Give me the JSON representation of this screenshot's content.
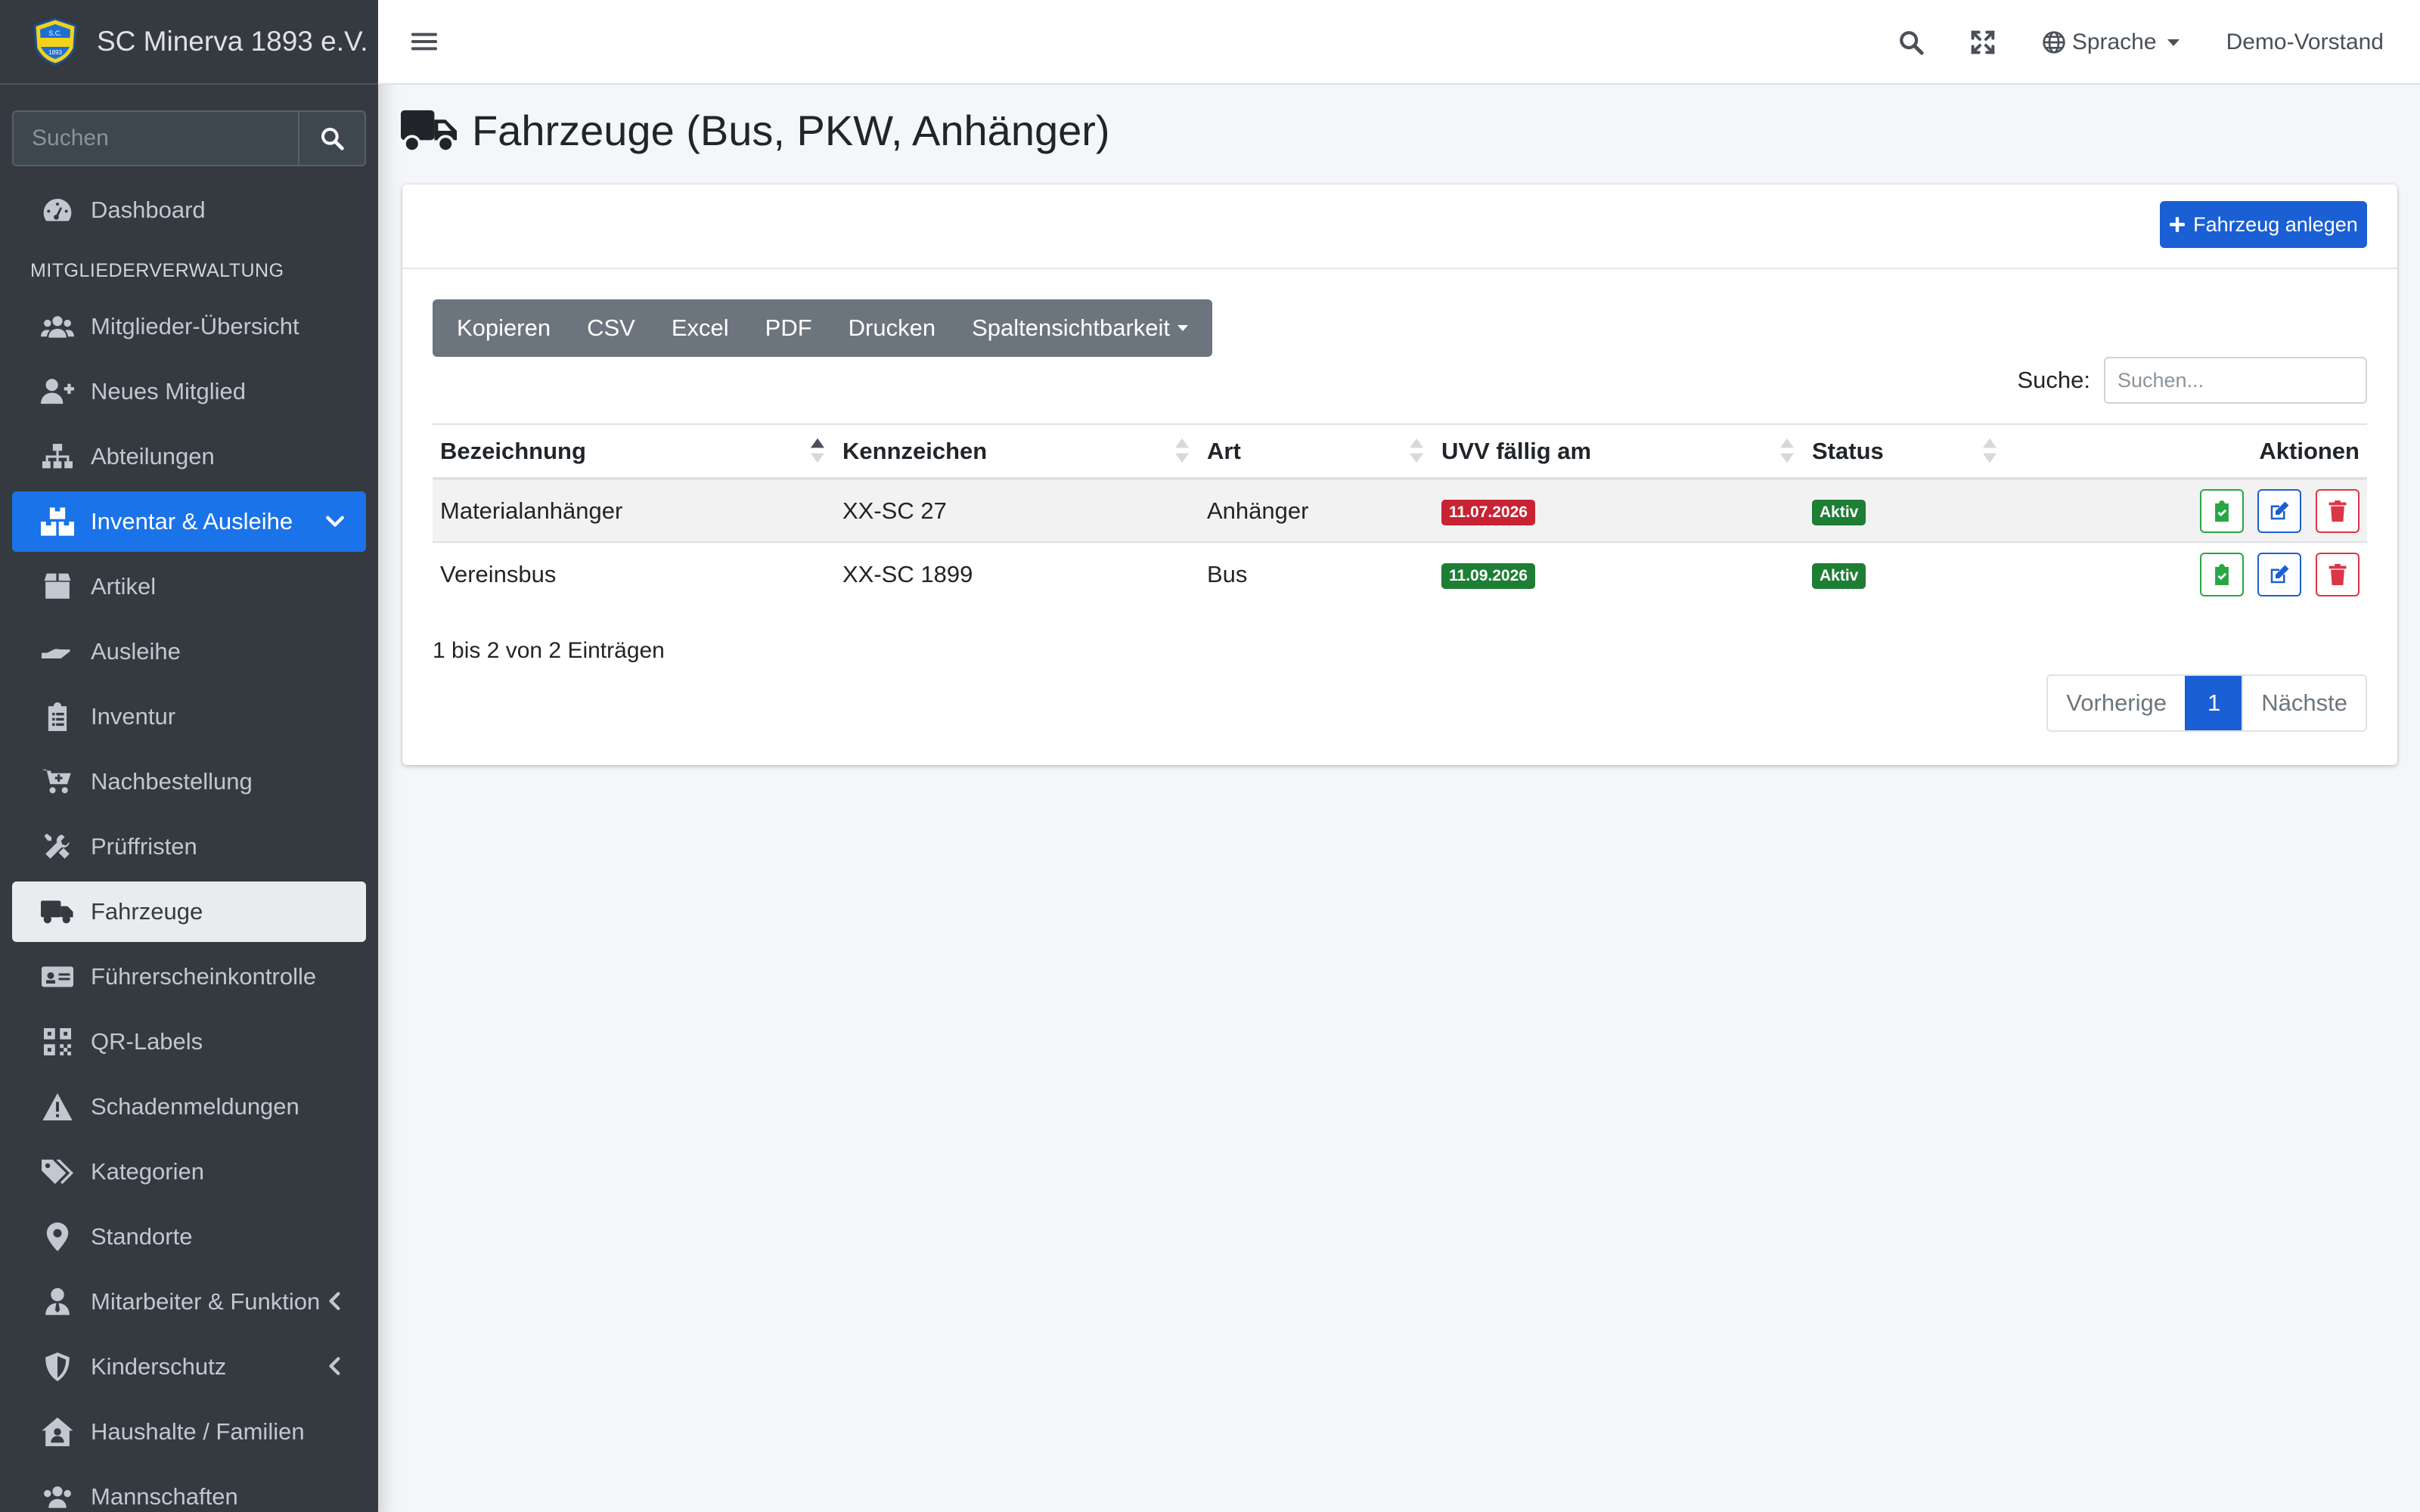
{
  "brand": {
    "name": "SC Minerva 1893 e.V."
  },
  "sidebar": {
    "search_placeholder": "Suchen",
    "items": [
      {
        "label": "Dashboard",
        "icon": "tachometer-icon"
      },
      {
        "header": "MITGLIEDERVERWALTUNG"
      },
      {
        "label": "Mitglieder-Übersicht",
        "icon": "users-icon"
      },
      {
        "label": "Neues Mitglied",
        "icon": "user-plus-icon"
      },
      {
        "label": "Abteilungen",
        "icon": "sitemap-icon"
      },
      {
        "label": "Inventar & Ausleihe",
        "icon": "boxes-icon",
        "state": "open"
      },
      {
        "label": "Artikel",
        "icon": "box-icon"
      },
      {
        "label": "Ausleihe",
        "icon": "hand-holding-icon"
      },
      {
        "label": "Inventur",
        "icon": "clipboard-list-icon"
      },
      {
        "label": "Nachbestellung",
        "icon": "cart-plus-icon"
      },
      {
        "label": "Prüffristen",
        "icon": "tools-icon"
      },
      {
        "label": "Fahrzeuge",
        "icon": "truck-icon",
        "state": "active"
      },
      {
        "label": "Führerscheinkontrolle",
        "icon": "id-card-icon"
      },
      {
        "label": "QR-Labels",
        "icon": "qrcode-icon"
      },
      {
        "label": "Schadenmeldungen",
        "icon": "warning-icon"
      },
      {
        "label": "Kategorien",
        "icon": "tags-icon"
      },
      {
        "label": "Standorte",
        "icon": "map-marker-icon"
      },
      {
        "label": "Mitarbeiter & Funktion",
        "icon": "user-tie-icon"
      },
      {
        "label": "Kinderschutz",
        "icon": "shield-icon"
      },
      {
        "label": "Haushalte / Familien",
        "icon": "house-user-icon"
      },
      {
        "label": "Mannschaften",
        "icon": "users-icon"
      }
    ]
  },
  "topbar": {
    "language_label": "Sprache",
    "user_label": "Demo-Vorstand"
  },
  "page": {
    "title": "Fahrzeuge (Bus, PKW, Anhänger)"
  },
  "card": {
    "add_button_label": "Fahrzeug anlegen"
  },
  "export_buttons": [
    "Kopieren",
    "CSV",
    "Excel",
    "PDF",
    "Drucken",
    "Spaltensichtbarkeit"
  ],
  "filter": {
    "label": "Suche:",
    "placeholder": "Suchen..."
  },
  "table": {
    "columns": [
      "Bezeichnung",
      "Kennzeichen",
      "Art",
      "UVV fällig am",
      "Status",
      "Aktionen"
    ],
    "rows": [
      {
        "bezeichnung": "Materialanhänger",
        "kennzeichen": "XX-SC 27",
        "art": "Anhänger",
        "uvv": "11.07.2026",
        "uvv_color": "#c82333",
        "status": "Aktiv"
      },
      {
        "bezeichnung": "Vereinsbus",
        "kennzeichen": "XX-SC 1899",
        "art": "Bus",
        "uvv": "11.09.2026",
        "uvv_color": "#1e7e34",
        "status": "Aktiv"
      }
    ]
  },
  "info": "1 bis 2 von 2 Einträgen",
  "pagination": {
    "prev": "Vorherige",
    "current": "1",
    "next": "Nächste"
  },
  "colors": {
    "sidebar_bg": "#343a40",
    "primary": "#1a5fd3",
    "active_parent": "#1a73e8",
    "danger": "#c82333",
    "success": "#1e7e34"
  }
}
